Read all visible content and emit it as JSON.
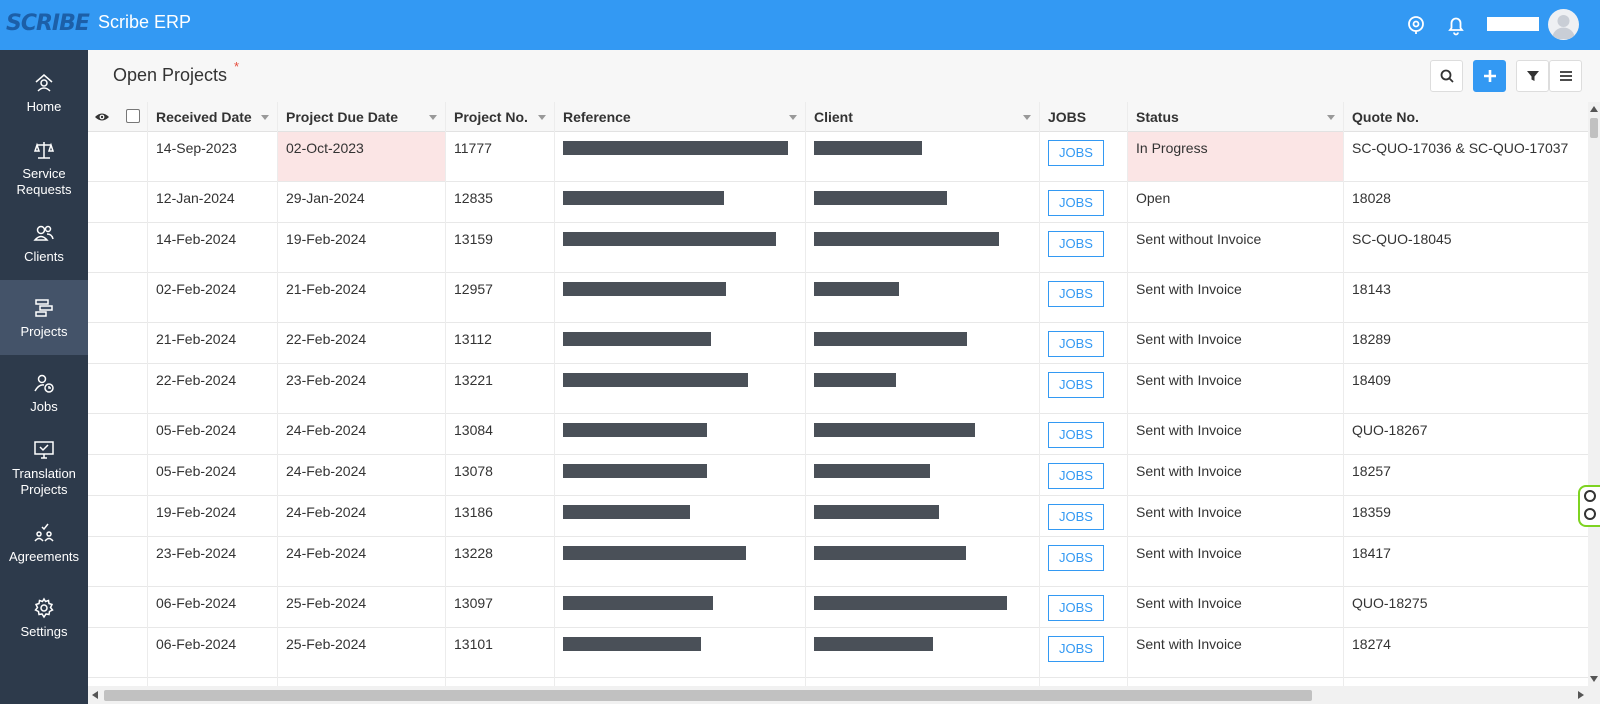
{
  "app": {
    "logo_text": "SCRIBE",
    "title": "Scribe ERP"
  },
  "topbar": {
    "icons": [
      "location-icon",
      "bell-icon",
      "user-avatar"
    ]
  },
  "sidebar": {
    "items": [
      {
        "label": "Home",
        "icon": "home-icon",
        "active": false
      },
      {
        "label": "Service\nRequests",
        "icon": "scales-icon",
        "active": false
      },
      {
        "label": "Clients",
        "icon": "users-icon",
        "active": false
      },
      {
        "label": "Projects",
        "icon": "projects-icon",
        "active": true
      },
      {
        "label": "Jobs",
        "icon": "user-clock-icon",
        "active": false
      },
      {
        "label": "Translation\nProjects",
        "icon": "monitor-icon",
        "active": false
      },
      {
        "label": "Agreements",
        "icon": "agreement-icon",
        "active": false
      },
      {
        "label": "Settings",
        "icon": "gear-icon",
        "active": false
      }
    ]
  },
  "page": {
    "title": "Open Projects",
    "required_mark": "*"
  },
  "table": {
    "columns": [
      "Received Date",
      "Project Due Date",
      "Project No.",
      "Reference",
      "Client",
      "JOBS",
      "Status",
      "Quote No."
    ],
    "jobs_label": "JOBS",
    "rows": [
      {
        "received": "14-Sep-2023",
        "due": "02-Oct-2023",
        "project_no": "11777",
        "status": "In Progress",
        "quote": "SC-QUO-17036 & SC-QUO-17037",
        "highlight": true
      },
      {
        "received": "12-Jan-2024",
        "due": "29-Jan-2024",
        "project_no": "12835",
        "status": "Open",
        "quote": "18028",
        "highlight": false
      },
      {
        "received": "14-Feb-2024",
        "due": "19-Feb-2024",
        "project_no": "13159",
        "status": "Sent without Invoice",
        "quote": "SC-QUO-18045",
        "highlight": false
      },
      {
        "received": "02-Feb-2024",
        "due": "21-Feb-2024",
        "project_no": "12957",
        "status": "Sent with Invoice",
        "quote": "18143",
        "highlight": false
      },
      {
        "received": "21-Feb-2024",
        "due": "22-Feb-2024",
        "project_no": "13112",
        "status": "Sent with Invoice",
        "quote": "18289",
        "highlight": false
      },
      {
        "received": "22-Feb-2024",
        "due": "23-Feb-2024",
        "project_no": "13221",
        "status": "Sent with Invoice",
        "quote": "18409",
        "highlight": false
      },
      {
        "received": "05-Feb-2024",
        "due": "24-Feb-2024",
        "project_no": "13084",
        "status": "Sent with Invoice",
        "quote": "QUO-18267",
        "highlight": false
      },
      {
        "received": "05-Feb-2024",
        "due": "24-Feb-2024",
        "project_no": "13078",
        "status": "Sent with Invoice",
        "quote": "18257",
        "highlight": false
      },
      {
        "received": "19-Feb-2024",
        "due": "24-Feb-2024",
        "project_no": "13186",
        "status": "Sent with Invoice",
        "quote": "18359",
        "highlight": false
      },
      {
        "received": "23-Feb-2024",
        "due": "24-Feb-2024",
        "project_no": "13228",
        "status": "Sent with Invoice",
        "quote": "18417",
        "highlight": false
      },
      {
        "received": "06-Feb-2024",
        "due": "25-Feb-2024",
        "project_no": "13097",
        "status": "Sent with Invoice",
        "quote": "QUO-18275",
        "highlight": false
      },
      {
        "received": "06-Feb-2024",
        "due": "25-Feb-2024",
        "project_no": "13101",
        "status": "Sent with Invoice",
        "quote": "18274",
        "highlight": false
      }
    ]
  },
  "colors": {
    "topbar": "#3399f3",
    "sidebar": "#2d3a4b",
    "sidebar_active": "#445369",
    "highlight": "#fbe5e5",
    "redaction": "#4a5058"
  }
}
